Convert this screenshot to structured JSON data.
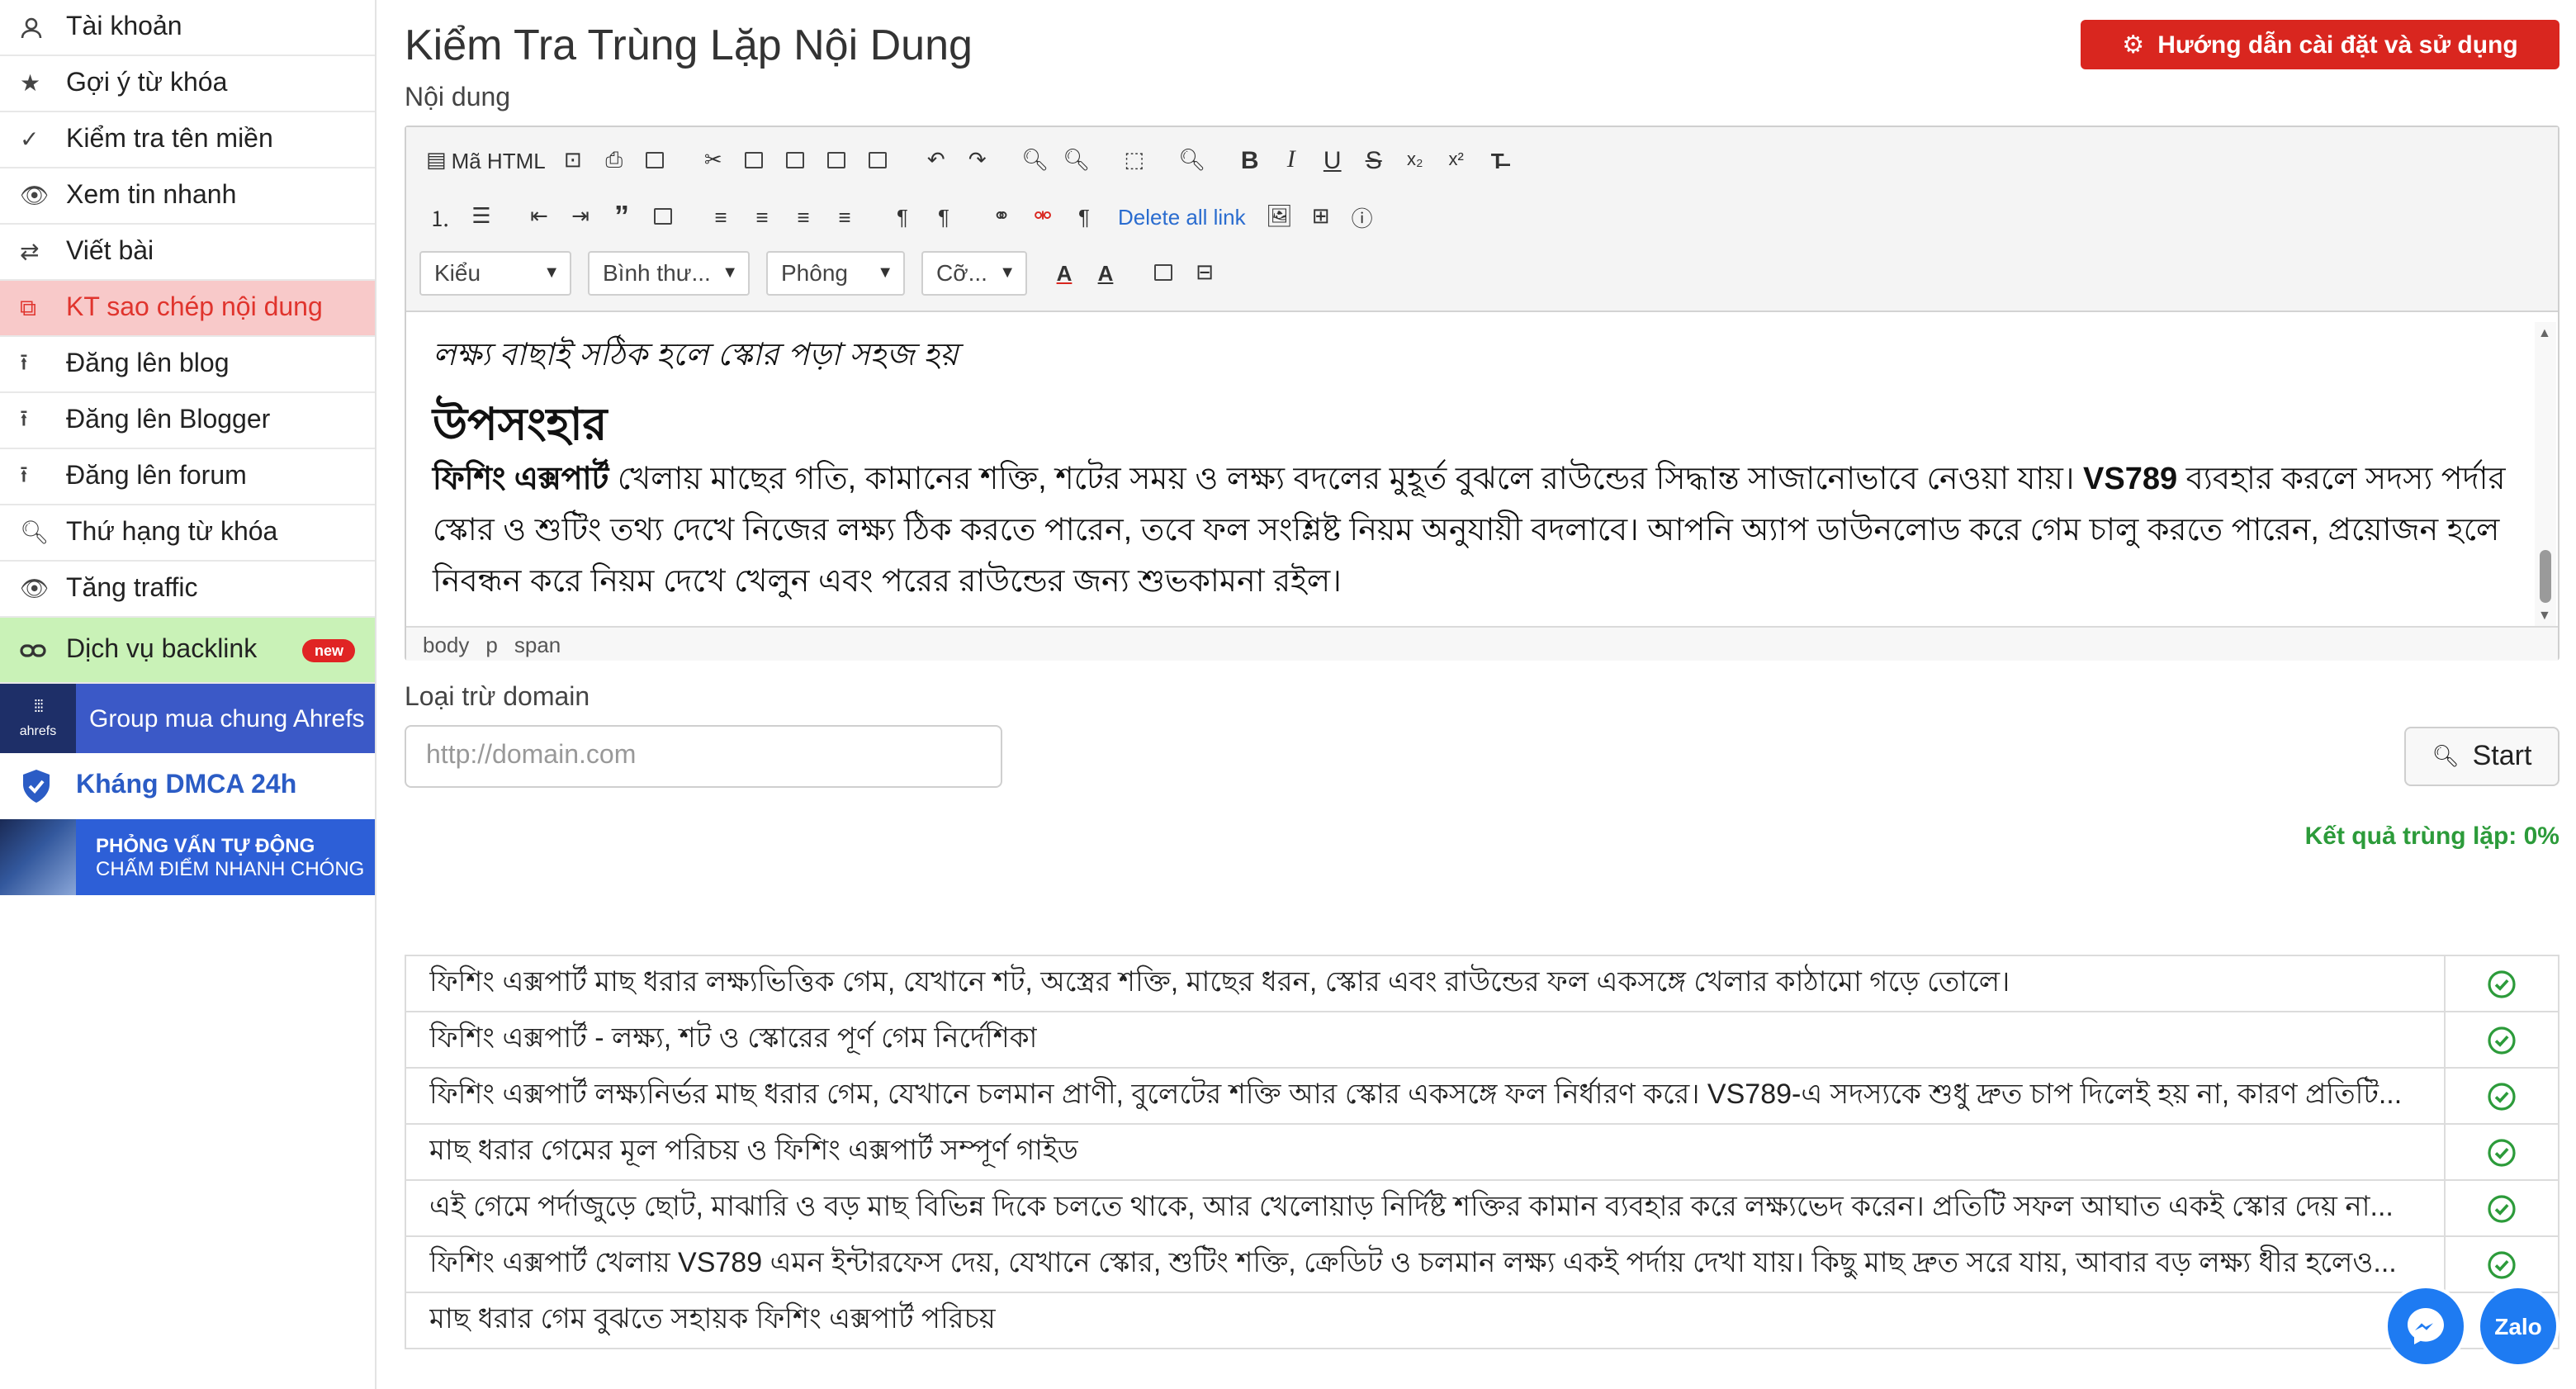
{
  "sidebar": {
    "items": [
      {
        "label": "Tài khoản",
        "icon": "user-icon"
      },
      {
        "label": "Gợi ý từ khóa",
        "icon": "star-icon"
      },
      {
        "label": "Kiểm tra tên miền",
        "icon": "check-icon"
      },
      {
        "label": "Xem tin nhanh",
        "icon": "eye-icon"
      },
      {
        "label": "Viết bài",
        "icon": "swap-icon"
      },
      {
        "label": "KT sao chép nội dung",
        "icon": "copy-icon",
        "active": true
      },
      {
        "label": "Đăng lên blog",
        "icon": "upload-icon"
      },
      {
        "label": "Đăng lên Blogger",
        "icon": "upload-icon"
      },
      {
        "label": "Đăng lên forum",
        "icon": "upload-icon"
      },
      {
        "label": "Thứ hạng từ khóa",
        "icon": "search-icon"
      },
      {
        "label": "Tăng traffic",
        "icon": "eye-icon"
      }
    ],
    "backlink": {
      "label": "Dịch vụ backlink",
      "badge": "new",
      "icon": "link-icon"
    },
    "ahrefs": {
      "logo": "ahrefs",
      "label": "Group mua chung Ahrefs"
    },
    "dmca": {
      "label": "Kháng DMCA 24h"
    },
    "interview": {
      "line1": "PHỎNG VẤN TỰ ĐỘNG",
      "line2": "CHẤM ĐIỂM NHANH CHÓNG"
    }
  },
  "header": {
    "title": "Kiểm Tra Trùng Lặp Nội Dung",
    "guide_button": "Hướng dẫn cài đặt và sử dụng"
  },
  "editor": {
    "label": "Nội dung",
    "toolbar": {
      "source_label": "Mã HTML",
      "delete_links": "Delete all link",
      "selects": [
        "Kiểu",
        "Bình thư...",
        "Phông",
        "Cỡ..."
      ]
    },
    "content": {
      "italic_line": "লক্ষ্য বাছাই সঠিক হলে স্কোর পড়া সহজ হয়",
      "heading": "উপসংহার",
      "para_bold": "ফিশিং এক্সপার্ট",
      "para_rest": " খেলায় মাছের গতি, কামানের শক্তি, শটের সময় ও লক্ষ্য বদলের মুহূর্ত বুঝলে রাউন্ডের সিদ্ধান্ত সাজানোভাবে নেওয়া যায়।",
      "para_brand": "VS789",
      "para_tail": " ব্যবহার করলে সদস্য পর্দার স্কোর ও শুটিং তথ্য দেখে নিজের লক্ষ্য ঠিক করতে পারেন, তবে ফল সংশ্লিষ্ট নিয়ম অনুযায়ী বদলাবে। আপনি অ্যাপ ডাউনলোড করে গেম চালু করতে পারেন, প্রয়োজন হলে নিবন্ধন করে নিয়ম দেখে খেলুন এবং পরের রাউন্ডের জন্য শুভকামনা রইল।"
    },
    "path": [
      "body",
      "p",
      "span"
    ]
  },
  "exclude": {
    "label": "Loại trừ domain",
    "placeholder": "http://domain.com"
  },
  "start_button": "Start",
  "result_text": "Kết quả trùng lặp: 0%",
  "results": [
    "ফিশিং এক্সপার্ট মাছ ধরার লক্ষ্যভিত্তিক গেম, যেখানে শট, অস্ত্রের শক্তি, মাছের ধরন, স্কোর এবং রাউন্ডের ফল একসঙ্গে খেলার কাঠামো গড়ে তোলে।",
    "ফিশিং এক্সপার্ট - লক্ষ্য, শট ও স্কোরের পূর্ণ গেম নির্দেশিকা",
    "ফিশিং এক্সপার্ট লক্ষ্যনির্ভর মাছ ধরার গেম, যেখানে চলমান প্রাণী, বুলেটের শক্তি আর স্কোর একসঙ্গে ফল নির্ধারণ করে। VS789-এ সদস্যকে শুধু দ্রুত চাপ দিলেই হয় না, কারণ প্রতিটি...",
    "মাছ ধরার গেমের মূল পরিচয় ও ফিশিং এক্সপার্ট সম্পূর্ণ গাইড",
    "এই গেমে পর্দাজুড়ে ছোট, মাঝারি ও বড় মাছ বিভিন্ন দিকে চলতে থাকে, আর খেলোয়াড় নির্দিষ্ট শক্তির কামান ব্যবহার করে লক্ষ্যভেদ করেন। প্রতিটি সফল আঘাত একই স্কোর দেয় না...",
    "ফিশিং এক্সপার্ট খেলায় VS789 এমন ইন্টারফেস দেয়, যেখানে স্কোর, শুটিং শক্তি, ক্রেডিট ও চলমান লক্ষ্য একই পর্দায় দেখা যায়। কিছু মাছ দ্রুত সরে যায়, আবার বড় লক্ষ্য ধীর হলেও...",
    "মাছ ধরার গেম বুঝতে সহায়ক ফিশিং এক্সপার্ট পরিচয়"
  ],
  "floating": {
    "messenger": "messenger-icon",
    "zalo": "Zalo"
  },
  "colors": {
    "accent_red": "#d9261f",
    "active_bg": "#f8c9c9",
    "success": "#2c9b3a",
    "link": "#2a6ccf"
  }
}
